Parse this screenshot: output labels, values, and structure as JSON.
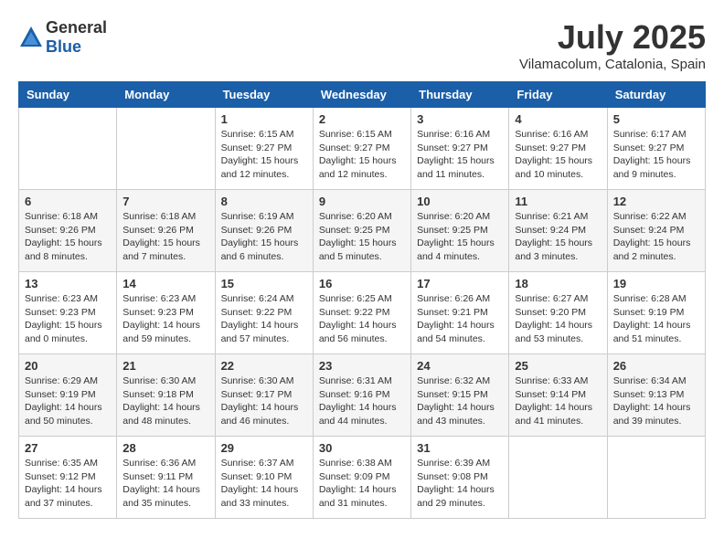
{
  "header": {
    "logo_general": "General",
    "logo_blue": "Blue",
    "month_year": "July 2025",
    "location": "Vilamacolum, Catalonia, Spain"
  },
  "weekdays": [
    "Sunday",
    "Monday",
    "Tuesday",
    "Wednesday",
    "Thursday",
    "Friday",
    "Saturday"
  ],
  "weeks": [
    [
      {
        "day": "",
        "info": ""
      },
      {
        "day": "",
        "info": ""
      },
      {
        "day": "1",
        "info": "Sunrise: 6:15 AM\nSunset: 9:27 PM\nDaylight: 15 hours\nand 12 minutes."
      },
      {
        "day": "2",
        "info": "Sunrise: 6:15 AM\nSunset: 9:27 PM\nDaylight: 15 hours\nand 12 minutes."
      },
      {
        "day": "3",
        "info": "Sunrise: 6:16 AM\nSunset: 9:27 PM\nDaylight: 15 hours\nand 11 minutes."
      },
      {
        "day": "4",
        "info": "Sunrise: 6:16 AM\nSunset: 9:27 PM\nDaylight: 15 hours\nand 10 minutes."
      },
      {
        "day": "5",
        "info": "Sunrise: 6:17 AM\nSunset: 9:27 PM\nDaylight: 15 hours\nand 9 minutes."
      }
    ],
    [
      {
        "day": "6",
        "info": "Sunrise: 6:18 AM\nSunset: 9:26 PM\nDaylight: 15 hours\nand 8 minutes."
      },
      {
        "day": "7",
        "info": "Sunrise: 6:18 AM\nSunset: 9:26 PM\nDaylight: 15 hours\nand 7 minutes."
      },
      {
        "day": "8",
        "info": "Sunrise: 6:19 AM\nSunset: 9:26 PM\nDaylight: 15 hours\nand 6 minutes."
      },
      {
        "day": "9",
        "info": "Sunrise: 6:20 AM\nSunset: 9:25 PM\nDaylight: 15 hours\nand 5 minutes."
      },
      {
        "day": "10",
        "info": "Sunrise: 6:20 AM\nSunset: 9:25 PM\nDaylight: 15 hours\nand 4 minutes."
      },
      {
        "day": "11",
        "info": "Sunrise: 6:21 AM\nSunset: 9:24 PM\nDaylight: 15 hours\nand 3 minutes."
      },
      {
        "day": "12",
        "info": "Sunrise: 6:22 AM\nSunset: 9:24 PM\nDaylight: 15 hours\nand 2 minutes."
      }
    ],
    [
      {
        "day": "13",
        "info": "Sunrise: 6:23 AM\nSunset: 9:23 PM\nDaylight: 15 hours\nand 0 minutes."
      },
      {
        "day": "14",
        "info": "Sunrise: 6:23 AM\nSunset: 9:23 PM\nDaylight: 14 hours\nand 59 minutes."
      },
      {
        "day": "15",
        "info": "Sunrise: 6:24 AM\nSunset: 9:22 PM\nDaylight: 14 hours\nand 57 minutes."
      },
      {
        "day": "16",
        "info": "Sunrise: 6:25 AM\nSunset: 9:22 PM\nDaylight: 14 hours\nand 56 minutes."
      },
      {
        "day": "17",
        "info": "Sunrise: 6:26 AM\nSunset: 9:21 PM\nDaylight: 14 hours\nand 54 minutes."
      },
      {
        "day": "18",
        "info": "Sunrise: 6:27 AM\nSunset: 9:20 PM\nDaylight: 14 hours\nand 53 minutes."
      },
      {
        "day": "19",
        "info": "Sunrise: 6:28 AM\nSunset: 9:19 PM\nDaylight: 14 hours\nand 51 minutes."
      }
    ],
    [
      {
        "day": "20",
        "info": "Sunrise: 6:29 AM\nSunset: 9:19 PM\nDaylight: 14 hours\nand 50 minutes."
      },
      {
        "day": "21",
        "info": "Sunrise: 6:30 AM\nSunset: 9:18 PM\nDaylight: 14 hours\nand 48 minutes."
      },
      {
        "day": "22",
        "info": "Sunrise: 6:30 AM\nSunset: 9:17 PM\nDaylight: 14 hours\nand 46 minutes."
      },
      {
        "day": "23",
        "info": "Sunrise: 6:31 AM\nSunset: 9:16 PM\nDaylight: 14 hours\nand 44 minutes."
      },
      {
        "day": "24",
        "info": "Sunrise: 6:32 AM\nSunset: 9:15 PM\nDaylight: 14 hours\nand 43 minutes."
      },
      {
        "day": "25",
        "info": "Sunrise: 6:33 AM\nSunset: 9:14 PM\nDaylight: 14 hours\nand 41 minutes."
      },
      {
        "day": "26",
        "info": "Sunrise: 6:34 AM\nSunset: 9:13 PM\nDaylight: 14 hours\nand 39 minutes."
      }
    ],
    [
      {
        "day": "27",
        "info": "Sunrise: 6:35 AM\nSunset: 9:12 PM\nDaylight: 14 hours\nand 37 minutes."
      },
      {
        "day": "28",
        "info": "Sunrise: 6:36 AM\nSunset: 9:11 PM\nDaylight: 14 hours\nand 35 minutes."
      },
      {
        "day": "29",
        "info": "Sunrise: 6:37 AM\nSunset: 9:10 PM\nDaylight: 14 hours\nand 33 minutes."
      },
      {
        "day": "30",
        "info": "Sunrise: 6:38 AM\nSunset: 9:09 PM\nDaylight: 14 hours\nand 31 minutes."
      },
      {
        "day": "31",
        "info": "Sunrise: 6:39 AM\nSunset: 9:08 PM\nDaylight: 14 hours\nand 29 minutes."
      },
      {
        "day": "",
        "info": ""
      },
      {
        "day": "",
        "info": ""
      }
    ]
  ]
}
